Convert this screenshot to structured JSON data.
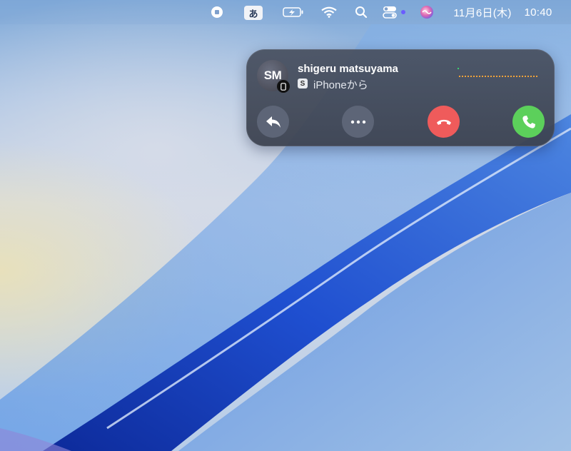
{
  "menubar": {
    "input_mode": "あ",
    "date": "11月6日(木)",
    "time": "10:40",
    "icons": [
      "screen-recording-stop-icon",
      "input-source-icon",
      "battery-charging-icon",
      "wifi-icon",
      "spotlight-search-icon",
      "control-center-icon",
      "siri-icon"
    ],
    "accent_dot_color": "#6a5cff"
  },
  "call": {
    "avatar_initials": "SM",
    "caller_name": "shigeru matsuyama",
    "app_badge": "S",
    "source": "iPhoneから",
    "buttons": [
      "reply-icon",
      "more-icon",
      "decline-phone-icon",
      "accept-phone-icon"
    ],
    "colors": {
      "decline": "#ef5b5b",
      "accept": "#5cd05b",
      "waveform": "#f0a23a",
      "waveform_level": "#3bd16f"
    }
  }
}
